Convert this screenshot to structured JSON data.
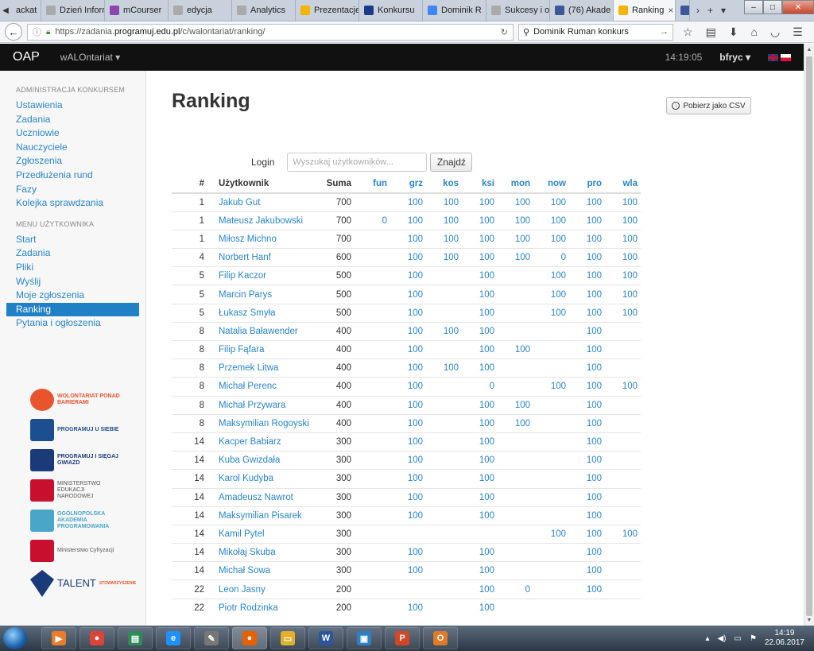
{
  "browser": {
    "tabs": [
      {
        "label": "ackat",
        "color": "#888888"
      },
      {
        "label": "Dzień Informat",
        "color": "#aaaaaa"
      },
      {
        "label": "mCourser",
        "color": "#8e44ad"
      },
      {
        "label": "edycja",
        "color": "#aaaaaa"
      },
      {
        "label": "Analytics",
        "color": "#aaaaaa"
      },
      {
        "label": "Prezentacje",
        "color": "#f4b400"
      },
      {
        "label": "Konkursu",
        "color": "#1a3a8a"
      },
      {
        "label": "Dominik R",
        "color": "#4285f4"
      },
      {
        "label": "Sukcesy i osiąg",
        "color": "#aaaaaa"
      },
      {
        "label": "(76) Akade",
        "color": "#3b5998"
      },
      {
        "label": "Ranking",
        "color": "#f4b400",
        "active": true
      },
      {
        "label": "",
        "color": "#3b5998"
      }
    ],
    "tab_close": "×",
    "tab_tools": [
      "›",
      "+",
      "▾"
    ],
    "window_controls": [
      "–",
      "□",
      "✕"
    ],
    "url_prefix": "https://zadania.",
    "url_host": "programuj.edu.pl",
    "url_path": "/c/walontariat/ranking/",
    "search_query": "Dominik Ruman konkurs"
  },
  "header": {
    "brand": "OAP",
    "contest": "wALOntariat ▾",
    "time": "14:19:05",
    "user": "bfryc ▾"
  },
  "sidebar": {
    "admin_heading": "ADMINISTRACJA KONKURSEM",
    "admin_items": [
      "Ustawienia",
      "Zadania",
      "Uczniowie",
      "Nauczyciele",
      "Zgłoszenia",
      "Przedłużenia rund",
      "Fazy",
      "Kolejka sprawdzania"
    ],
    "user_heading": "MENU UŻYTKOWNIKA",
    "user_items": [
      "Start",
      "Zadania",
      "Pliki",
      "Wyślij",
      "Moje zgłoszenia",
      "Ranking",
      "Pytania i ogłoszenia"
    ],
    "active_item": "Ranking",
    "sponsors": [
      {
        "text": "WOLONTARIAT PONAD BARIERAMI",
        "icon": "handshake-heart-icon"
      },
      {
        "text": "PROGRAMUJ U SIEBIE",
        "icon": "house-icon"
      },
      {
        "text": "PROGRAMUJ I SIĘGAJ GWIAZD",
        "icon": "dots-cross-icon"
      },
      {
        "text": "MINISTERSTWO EDUKACJI NARODOWEJ",
        "icon": "eagle-emblem-icon"
      },
      {
        "text": "OGÓLNOPOLSKA AKADEMIA PROGRAMOWANIA",
        "icon": "puzzle-icon"
      },
      {
        "text": "Ministerstwo Cyfryzacji",
        "icon": "eagle-emblem-icon"
      },
      {
        "text": "TALENT",
        "subtext": "STOWARZYSZENIE",
        "icon": "diamond-icon"
      }
    ]
  },
  "main": {
    "title": "Ranking",
    "csv_button": "Pobierz jako CSV",
    "search_label": "Login",
    "search_placeholder": "Wyszukaj użytkowników...",
    "search_button": "Znajdź",
    "columns": [
      "#",
      "Użytkownik",
      "Suma",
      "fun",
      "grz",
      "kos",
      "ksi",
      "mon",
      "now",
      "pro",
      "wla"
    ],
    "rows": [
      [
        "1",
        "Jakub Gut",
        "700",
        "",
        "100",
        "100",
        "100",
        "100",
        "100",
        "100",
        "100"
      ],
      [
        "1",
        "Mateusz Jakubowski",
        "700",
        "0",
        "100",
        "100",
        "100",
        "100",
        "100",
        "100",
        "100"
      ],
      [
        "1",
        "Miłosz Michno",
        "700",
        "",
        "100",
        "100",
        "100",
        "100",
        "100",
        "100",
        "100"
      ],
      [
        "4",
        "Norbert Hanf",
        "600",
        "",
        "100",
        "100",
        "100",
        "100",
        "0",
        "100",
        "100"
      ],
      [
        "5",
        "Filip Kaczor",
        "500",
        "",
        "100",
        "",
        "100",
        "",
        "100",
        "100",
        "100"
      ],
      [
        "5",
        "Marcin Parys",
        "500",
        "",
        "100",
        "",
        "100",
        "",
        "100",
        "100",
        "100"
      ],
      [
        "5",
        "Łukasz Smyła",
        "500",
        "",
        "100",
        "",
        "100",
        "",
        "100",
        "100",
        "100"
      ],
      [
        "8",
        "Natalia Baławender",
        "400",
        "",
        "100",
        "100",
        "100",
        "",
        "",
        "100",
        ""
      ],
      [
        "8",
        "Filip Fąfara",
        "400",
        "",
        "100",
        "",
        "100",
        "100",
        "",
        "100",
        ""
      ],
      [
        "8",
        "Przemek Litwa",
        "400",
        "",
        "100",
        "100",
        "100",
        "",
        "",
        "100",
        ""
      ],
      [
        "8",
        "Michał Perenc",
        "400",
        "",
        "100",
        "",
        "0",
        "",
        "100",
        "100",
        "100"
      ],
      [
        "8",
        "Michał Przywara",
        "400",
        "",
        "100",
        "",
        "100",
        "100",
        "",
        "100",
        ""
      ],
      [
        "8",
        "Maksymilian Rogoyski",
        "400",
        "",
        "100",
        "",
        "100",
        "100",
        "",
        "100",
        ""
      ],
      [
        "14",
        "Kacper Babiarz",
        "300",
        "",
        "100",
        "",
        "100",
        "",
        "",
        "100",
        ""
      ],
      [
        "14",
        "Kuba Gwizdała",
        "300",
        "",
        "100",
        "",
        "100",
        "",
        "",
        "100",
        ""
      ],
      [
        "14",
        "Karol Kudyba",
        "300",
        "",
        "100",
        "",
        "100",
        "",
        "",
        "100",
        ""
      ],
      [
        "14",
        "Amadeusz Nawrot",
        "300",
        "",
        "100",
        "",
        "100",
        "",
        "",
        "100",
        ""
      ],
      [
        "14",
        "Maksymilian Pisarek",
        "300",
        "",
        "100",
        "",
        "100",
        "",
        "",
        "100",
        ""
      ],
      [
        "14",
        "Kamil Pytel",
        "300",
        "",
        "",
        "",
        "",
        "",
        "100",
        "100",
        "100"
      ],
      [
        "14",
        "Mikołaj Skuba",
        "300",
        "",
        "100",
        "",
        "100",
        "",
        "",
        "100",
        ""
      ],
      [
        "14",
        "Michał Sowa",
        "300",
        "",
        "100",
        "",
        "100",
        "",
        "",
        "100",
        ""
      ],
      [
        "22",
        "Leon Jasny",
        "200",
        "",
        "",
        "",
        "100",
        "0",
        "",
        "100",
        ""
      ],
      [
        "22",
        "Piotr Rodzinka",
        "200",
        "",
        "100",
        "",
        "100",
        "",
        "",
        "",
        ""
      ]
    ]
  },
  "taskbar": {
    "apps": [
      {
        "name": "media-player",
        "color": "#e87d2a",
        "glyph": "▶"
      },
      {
        "name": "chrome",
        "color": "#db4437",
        "glyph": "●"
      },
      {
        "name": "spreadsheet",
        "color": "#2e8b57",
        "glyph": "▤"
      },
      {
        "name": "internet-explorer",
        "color": "#1e90ff",
        "glyph": "e"
      },
      {
        "name": "tool",
        "color": "#777777",
        "glyph": "✎"
      },
      {
        "name": "firefox",
        "color": "#e66000",
        "glyph": "●",
        "active": true
      },
      {
        "name": "explorer",
        "color": "#e1b12c",
        "glyph": "▭"
      },
      {
        "name": "word",
        "color": "#2b579a",
        "glyph": "W"
      },
      {
        "name": "remote",
        "color": "#2f7fc1",
        "glyph": "▣"
      },
      {
        "name": "powerpoint",
        "color": "#d24726",
        "glyph": "P"
      },
      {
        "name": "outlook",
        "color": "#e07b28",
        "glyph": "O"
      }
    ],
    "time": "14:19",
    "date": "22.06.2017"
  },
  "colors": {
    "link": "#2a85c6",
    "active_bg": "#1f80c6",
    "header_bg": "#111111"
  }
}
